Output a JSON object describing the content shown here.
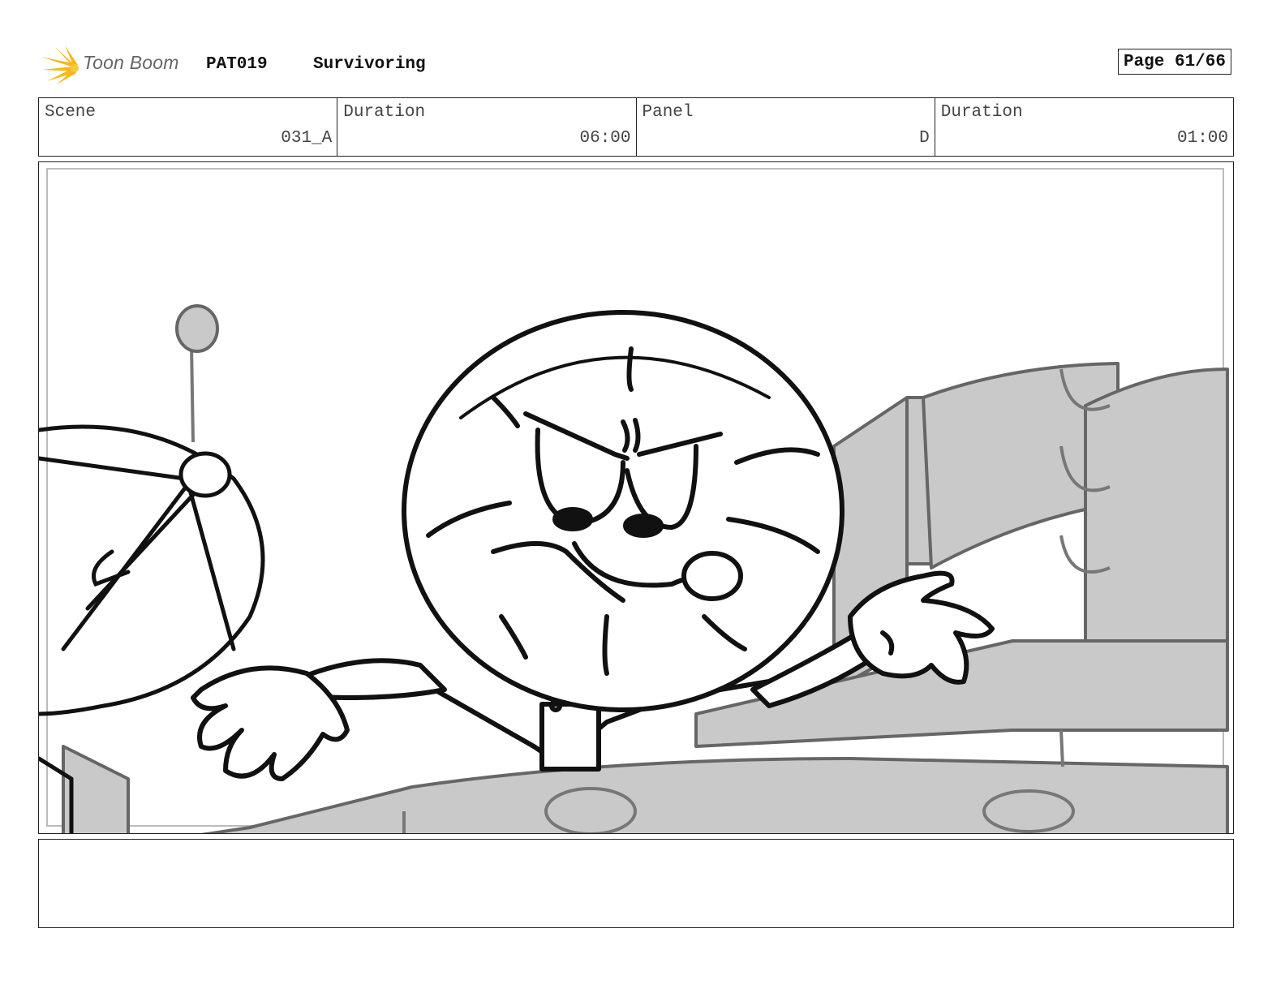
{
  "header": {
    "logo_text": "Toon Boom",
    "project_code": "PAT019",
    "episode_title": "Survivoring",
    "page_label": "Page 61/66"
  },
  "info": {
    "scene_label": "Scene",
    "scene_value": "031_A",
    "scene_duration_label": "Duration",
    "scene_duration_value": "06:00",
    "panel_label": "Panel",
    "panel_value": "D",
    "panel_duration_label": "Duration",
    "panel_duration_value": "01:00"
  },
  "panel": {
    "image_icon": "storyboard-sketch-angry-round-head-character"
  },
  "notes": {
    "text": ""
  },
  "colors": {
    "logo_accent": "#f5b81c",
    "sketch_gray": "#c8c8c8",
    "ink": "#111111"
  }
}
